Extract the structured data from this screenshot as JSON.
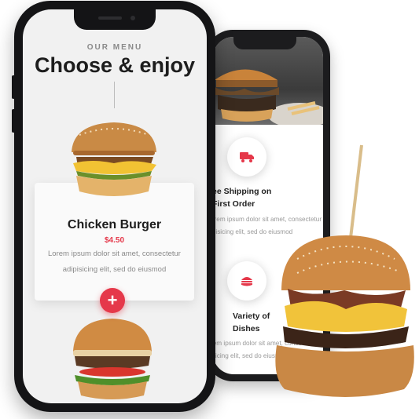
{
  "front_screen": {
    "kicker": "OUR MENU",
    "heading": "Choose & enjoy",
    "card": {
      "title": "Chicken Burger",
      "price": "$4.50",
      "description": "Lorem ipsum dolor sit amet, consectetur\nadipisicing elit, sed do eiusmod"
    },
    "add_button": "+"
  },
  "back_screen": {
    "features": [
      {
        "icon": "truck-icon",
        "title": "ee Shipping on\nFirst Order",
        "text": "orem ipsum dolor sit amet, consectetur\nipisicing elit, sed do eiusmod"
      },
      {
        "icon": "burger-icon",
        "title": "Variety of\nDishes",
        "text": "rem ipsum dolor sit amet, consectetur\nisicing elit, sed do eiusmod"
      }
    ]
  },
  "colors": {
    "accent": "#e5384a",
    "phone_frame": "#141416",
    "heading": "#1d1d1d"
  }
}
